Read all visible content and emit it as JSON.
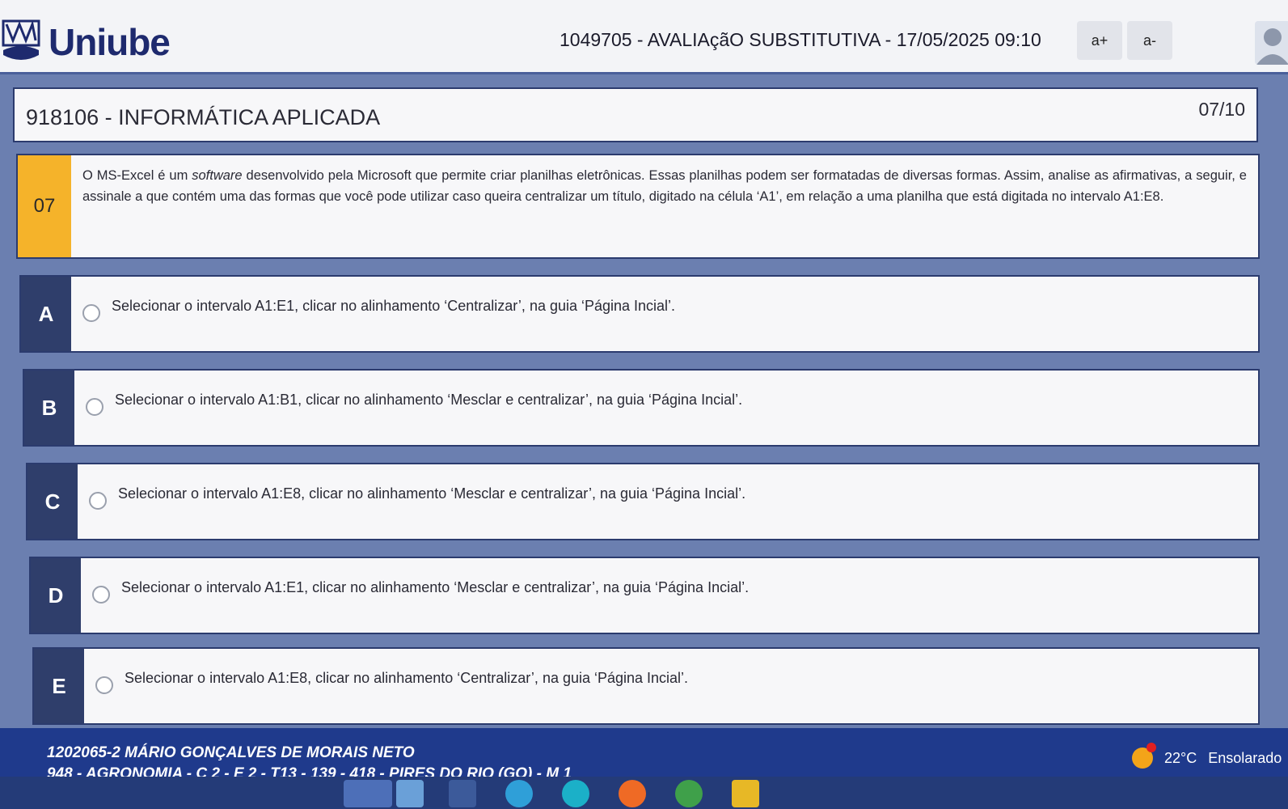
{
  "header": {
    "logo_text": "Uniube",
    "exam_title": "1049705 - AVALIAçãO SUBSTITUTIVA - 17/05/2025 09:10",
    "font_increase": "a+",
    "font_decrease": "a-"
  },
  "course": {
    "name": "918106 - INFORMÁTICA APLICADA",
    "progress": "07/10"
  },
  "question": {
    "number": "07",
    "text_before": "O MS-Excel é um ",
    "text_italic": "software",
    "text_after": " desenvolvido pela Microsoft que permite criar planilhas eletrônicas. Essas planilhas podem ser formatadas de diversas formas. Assim, analise as afirmativas, a seguir, e assinale a que contém uma das formas que você pode utilizar caso queira centralizar um título, digitado na célula ‘A1’, em relação a uma planilha que está digitada no intervalo A1:E8."
  },
  "options": [
    {
      "letter": "A",
      "text": "Selecionar o intervalo A1:E1, clicar no alinhamento ‘Centralizar’, na guia ‘Página Incial’."
    },
    {
      "letter": "B",
      "text": "Selecionar o intervalo A1:B1, clicar no alinhamento ‘Mesclar e centralizar’, na guia ‘Página Incial’."
    },
    {
      "letter": "C",
      "text": "Selecionar o intervalo A1:E8, clicar no alinhamento ‘Mesclar e centralizar’, na guia ‘Página Incial’."
    },
    {
      "letter": "D",
      "text": "Selecionar o intervalo A1:E1, clicar no alinhamento ‘Mesclar e centralizar’, na guia ‘Página Incial’."
    },
    {
      "letter": "E",
      "text": "Selecionar o intervalo A1:E8, clicar no alinhamento ‘Centralizar’, na guia ‘Página Incial’."
    }
  ],
  "footer": {
    "student_name": "1202065-2 MÁRIO GONÇALVES DE MORAIS NETO",
    "student_course": "948 - AGRONOMIA - C 2 - E 2 - T13 - 139 - 418 - PIRES DO RIO (GO) - M 1"
  },
  "weather": {
    "temperature": "22°C",
    "condition": "Ensolarado"
  },
  "colors": {
    "accent": "#f5b32a",
    "letter_bg": "#2f3e6b",
    "footer_bg": "#1f3a8c"
  }
}
